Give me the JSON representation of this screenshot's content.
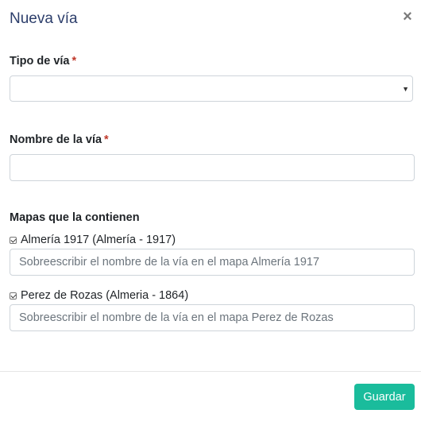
{
  "modal": {
    "title": "Nueva vía",
    "close_symbol": "×"
  },
  "fields": {
    "tipo": {
      "label": "Tipo de vía",
      "required_mark": "*",
      "selected_value": ""
    },
    "nombre": {
      "label": "Nombre de la vía",
      "required_mark": "*",
      "value": ""
    }
  },
  "maps": {
    "heading": "Mapas que la contienen",
    "items": [
      {
        "label": "Almería 1917 (Almería - 1917)",
        "checked": true,
        "placeholder": "Sobreescribir el nombre de la vía en el mapa Almería 1917"
      },
      {
        "label": "Perez de Rozas (Almeria - 1864)",
        "checked": true,
        "placeholder": "Sobreescribir el nombre de la vía en el mapa Perez de Rozas"
      }
    ]
  },
  "footer": {
    "save_label": "Guardar"
  },
  "colors": {
    "primary": "#1abc9c",
    "title": "#2c3e6b",
    "required": "#c0392b"
  },
  "icons": {
    "close": "close-icon",
    "select_arrow": "chevron-down-icon",
    "checkbox": "checkmark-icon"
  }
}
